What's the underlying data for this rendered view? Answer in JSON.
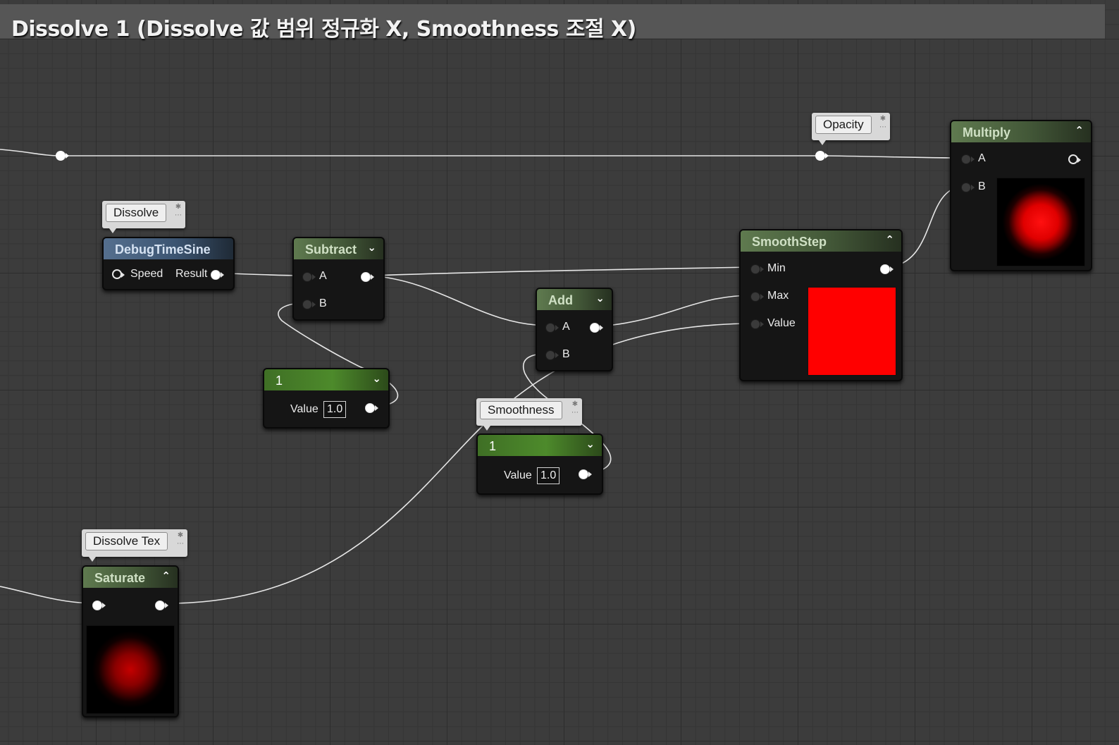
{
  "comment": {
    "title": "Dissolve 1 (Dissolve 값 범위 정규화 X, Smoothness 조절 X)"
  },
  "parameters": {
    "opacity": "Opacity",
    "dissolve": "Dissolve",
    "smoothness": "Smoothness",
    "dissolve_tex": "Dissolve Tex"
  },
  "nodes": {
    "debug_time_sine": {
      "title": "DebugTimeSine",
      "input": "Speed",
      "output": "Result"
    },
    "subtract": {
      "title": "Subtract",
      "input_a": "A",
      "input_b": "B"
    },
    "constant_1": {
      "title": "1",
      "value_label": "Value",
      "value": "1.0"
    },
    "add": {
      "title": "Add",
      "input_a": "A",
      "input_b": "B"
    },
    "constant_2": {
      "title": "1",
      "value_label": "Value",
      "value": "1.0"
    },
    "smoothstep": {
      "title": "SmoothStep",
      "min": "Min",
      "max": "Max",
      "value": "Value"
    },
    "multiply": {
      "title": "Multiply",
      "input_a": "A",
      "input_b": "B"
    },
    "saturate": {
      "title": "Saturate"
    }
  },
  "icons": {
    "collapse": "chevron-up-icon",
    "expand": "chevron-down-icon",
    "pin": "pin-icon"
  },
  "colors": {
    "wire": "#e6e6e6",
    "material_node_header": "#5f7a4f",
    "debug_node_header": "#556f8e",
    "constant_node_header": "#4d8a2b",
    "smoothstep_preview": "#ff0000"
  }
}
